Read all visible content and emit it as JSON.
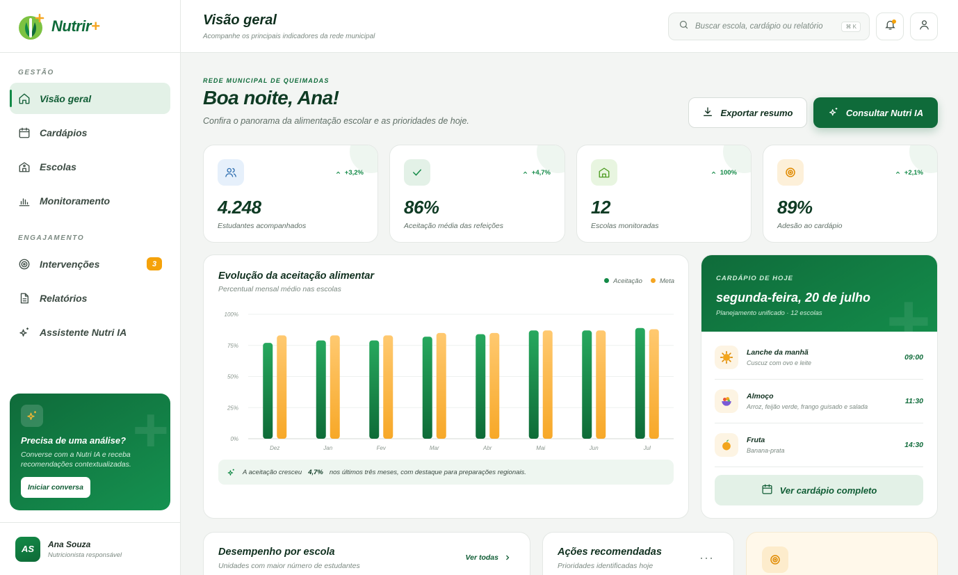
{
  "brand": {
    "name": "Nutrir",
    "plus": "+"
  },
  "sidebar": {
    "section_gestao": "GESTÃO",
    "section_engajamento": "ENGAJAMENTO",
    "items": [
      {
        "label": "Visão geral",
        "icon": "home-icon"
      },
      {
        "label": "Cardápios",
        "icon": "calendar-icon"
      },
      {
        "label": "Escolas",
        "icon": "school-icon"
      },
      {
        "label": "Monitoramento",
        "icon": "bar-chart-icon"
      },
      {
        "label": "Intervenções",
        "icon": "target-icon",
        "badge": "3"
      },
      {
        "label": "Relatórios",
        "icon": "document-icon"
      },
      {
        "label": "Assistente Nutri IA",
        "icon": "sparkle-icon"
      }
    ],
    "promo": {
      "title": "Precisa de uma análise?",
      "text": "Converse com a Nutri IA e receba recomendações contextualizadas.",
      "button": "Iniciar conversa"
    },
    "user": {
      "initials": "AS",
      "name": "Ana Souza",
      "role": "Nutricionista responsável"
    }
  },
  "header": {
    "title": "Visão geral",
    "subtitle": "Acompanhe os principais indicadores da rede municipal",
    "search_placeholder": "Buscar escola, cardápio ou relatório",
    "shortcut": "⌘ K"
  },
  "hero": {
    "eyebrow": "REDE MUNICIPAL DE QUEIMADAS",
    "greeting": "Boa noite, Ana!",
    "subtitle": "Confira o panorama da alimentação escolar e as prioridades de hoje.",
    "export_label": "Exportar resumo",
    "ai_label": "Consultar Nutri IA"
  },
  "kpis": [
    {
      "value": "4.248",
      "label": "Estudantes acompanhados",
      "delta": "+3,2%",
      "icon": "users-icon",
      "tint": "#e6f0fb",
      "color": "#2f6fb0"
    },
    {
      "value": "86%",
      "label": "Aceitação média das refeições",
      "delta": "+4,7%",
      "icon": "check-icon",
      "tint": "#e3f1e7",
      "color": "#138a47"
    },
    {
      "value": "12",
      "label": "Escolas monitoradas",
      "delta": "100%",
      "icon": "school-icon",
      "tint": "#e8f5e0",
      "color": "#4b9a1e"
    },
    {
      "value": "89%",
      "label": "Adesão ao cardápio",
      "delta": "+2,1%",
      "icon": "target-icon",
      "tint": "#fdf0d9",
      "color": "#e08a00"
    }
  ],
  "chart_card": {
    "title": "Evolução da aceitação alimentar",
    "subtitle": "Percentual mensal médio nas escolas",
    "insight_pre": "A aceitação cresceu",
    "insight_value": "4,7%",
    "insight_post": "nos últimos três meses, com destaque para preparações regionais."
  },
  "chart_data": {
    "type": "bar",
    "categories": [
      "Dez",
      "Jan",
      "Fev",
      "Mar",
      "Abr",
      "Mai",
      "Jun",
      "Jul"
    ],
    "series": [
      {
        "name": "Aceitação",
        "values": [
          77,
          79,
          79,
          82,
          84,
          87,
          87,
          89
        ],
        "color": "#138a47"
      },
      {
        "name": "Meta",
        "values": [
          83,
          83,
          83,
          85,
          85,
          87,
          87,
          88
        ],
        "color": "#f5a623"
      }
    ],
    "ylim": [
      0,
      100
    ],
    "yticks": [
      "0%",
      "25%",
      "50%",
      "75%",
      "100%"
    ],
    "grid": true,
    "legend": "top-right"
  },
  "menu": {
    "eyebrow": "CARDÁPIO DE HOJE",
    "date": "segunda-feira, 20 de julho",
    "plan": "Planejamento unificado · 12 escolas",
    "meals": [
      {
        "name": "Lanche da manhã",
        "desc": "Cuscuz com ovo e leite",
        "time": "09:00",
        "icon": "sun-food-icon"
      },
      {
        "name": "Almoço",
        "desc": "Arroz, feijão verde, frango guisado e salada",
        "time": "11:30",
        "icon": "plate-icon"
      },
      {
        "name": "Fruta",
        "desc": "Banana-prata",
        "time": "14:30",
        "icon": "fruit-icon"
      }
    ],
    "button": "Ver cardápio completo"
  },
  "bottom": {
    "perf_title": "Desempenho por escola",
    "perf_sub": "Unidades com maior número de estudantes",
    "perf_link": "Ver todas",
    "actions_title": "Ações recomendadas",
    "actions_sub": "Prioridades identificadas hoje"
  }
}
